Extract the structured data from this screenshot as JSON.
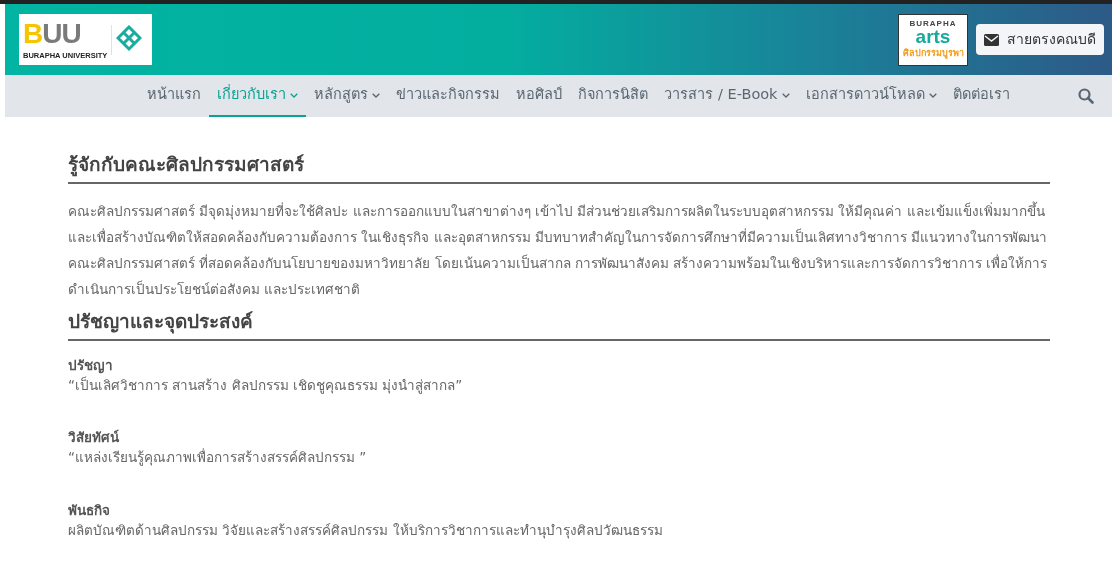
{
  "header": {
    "logo": {
      "mark": "BUU",
      "university": "BURAPHA UNIVERSITY"
    },
    "journal_logo": {
      "top": "BURAPHA",
      "main": "arts",
      "bottom": "ศิลปกรรมบูรพา"
    },
    "dean_button": "สายตรงคณบดี"
  },
  "nav": {
    "items": [
      {
        "label": "หน้าแรก",
        "selected": false,
        "dropdown": false
      },
      {
        "label": "เกี่ยวกับเรา",
        "selected": true,
        "dropdown": true
      },
      {
        "label": "หลักสูตร",
        "selected": false,
        "dropdown": true
      },
      {
        "label": "ข่าวและกิจกรรม",
        "selected": false,
        "dropdown": false
      },
      {
        "label": "หอศิลป์",
        "selected": false,
        "dropdown": false
      },
      {
        "label": "กิจการนิสิต",
        "selected": false,
        "dropdown": false
      },
      {
        "label": "วารสาร / E-Book",
        "selected": false,
        "dropdown": true
      },
      {
        "label": "เอกสารดาวน์โหลด",
        "selected": false,
        "dropdown": true
      },
      {
        "label": "ติดต่อเรา",
        "selected": false,
        "dropdown": false
      }
    ]
  },
  "sections": [
    {
      "heading": "รู้จักกับคณะศิลปกรรมศาสตร์",
      "paragraph": "คณะศิลปกรรมศาสตร์ มีจุดมุ่งหมายที่จะใช้ศิลปะ และการออกแบบในสาขาต่างๆ เข้าไป มีส่วนช่วยเสริมการผลิตในระบบอุตสาหกรรม ให้มีคุณค่า และเข้มแข็งเพิ่มมากขึ้น และเพื่อสร้างบัณฑิตให้สอดคล้องกับความต้องการ ในเชิงธุรกิจ และอุตสาหกรรม มีบทบาทสำคัญในการจัดการศึกษาที่มีความเป็นเลิศทางวิชาการ มีแนวทางในการพัฒนา คณะศิลปกรรมศาสตร์ ที่สอดคล้องกับนโยบายของมหาวิทยาลัย โดยเน้นความเป็นสากล การพัฒนาสังคม สร้างความพร้อมในเชิงบริหารและการจัดการวิชาการ เพื่อให้การดำเนินการเป็นประโยชน์ต่อสังคม และประเทศชาติ"
    },
    {
      "heading": "ปรัชญาและจุดประสงค์",
      "items": [
        {
          "title": "ปรัชญา",
          "text": "“เป็นเลิศวิชาการ สานสร้าง ศิลปกรรม เชิดชูคุณธรรม มุ่งนำสู่สากล”"
        },
        {
          "title": "วิสัยทัศน์",
          "text": "“แหล่งเรียนรู้คุณภาพเพื่อการสร้างสรรค์ศิลปกรรม ”"
        },
        {
          "title": "พันธกิจ",
          "text": "ผลิตบัณฑิตด้านศิลปกรรม วิจัยและสร้างสรรค์ศิลปกรรม ให้บริการวิชาการและทำนุบำรุงศิลปวัฒนธรรม"
        }
      ]
    }
  ]
}
